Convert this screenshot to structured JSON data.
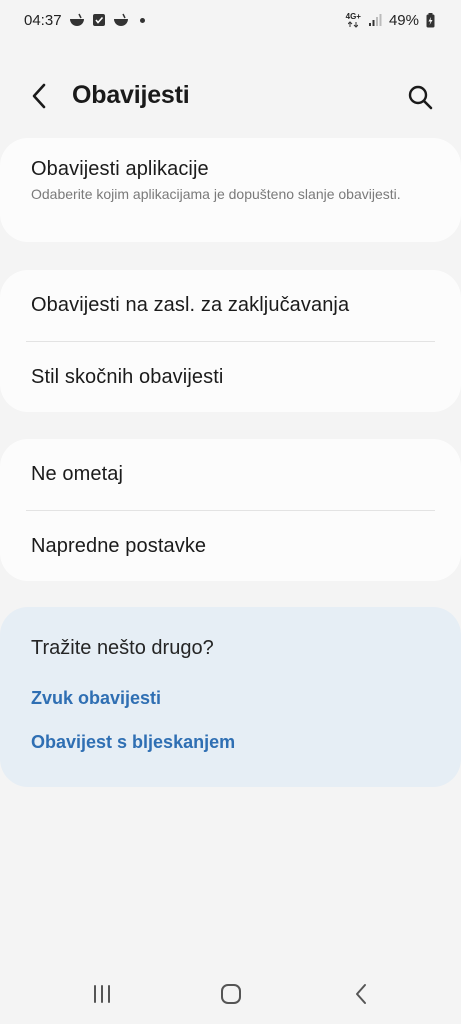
{
  "status_bar": {
    "time": "04:37",
    "network": "4G+",
    "battery": "49%",
    "notification_icons": [
      "bowl-icon",
      "checkbox-icon",
      "bowl-icon",
      "dot-icon"
    ]
  },
  "header": {
    "title": "Obavijesti",
    "back_icon": "chevron-left-icon",
    "search_icon": "search-icon"
  },
  "app_notifications": {
    "title": "Obavijesti aplikacije",
    "subtitle": "Odaberite kojim aplikacijama je dopušteno slanje obavijesti."
  },
  "group_two": {
    "items": [
      {
        "label": "Obavijesti na zasl. za zaključavanja"
      },
      {
        "label": "Stil skočnih obavijesti"
      }
    ]
  },
  "group_three": {
    "items": [
      {
        "label": "Ne ometaj"
      },
      {
        "label": "Napredne postavke"
      }
    ]
  },
  "suggestions": {
    "title": "Tražite nešto drugo?",
    "links": [
      {
        "label": "Zvuk obavijesti"
      },
      {
        "label": "Obavijest s bljeskanjem"
      }
    ]
  },
  "nav_bar": {
    "recents_icon": "recents-icon",
    "home_icon": "home-icon",
    "back_icon": "back-icon"
  },
  "colors": {
    "background": "#f4f4f4",
    "card": "#fcfcfc",
    "suggest_card": "#e6eef5",
    "link": "#2f6fb3"
  }
}
